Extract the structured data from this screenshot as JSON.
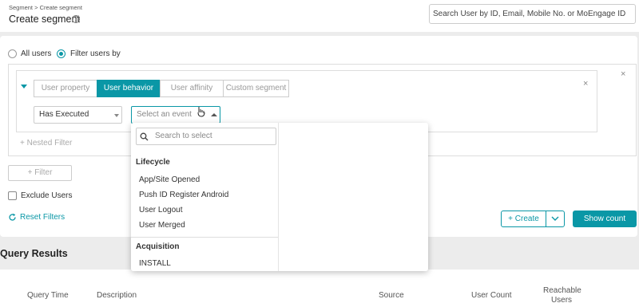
{
  "header": {
    "breadcrumb": "Segment > Create segment",
    "title": "Create segment",
    "help_glyph": "?",
    "search_text": "Search User by ID, Email, Mobile No. or MoEngage ID"
  },
  "audience": {
    "all_users_label": "All users",
    "filter_users_label": "Filter users by",
    "selected": "Filter users by"
  },
  "tabs": [
    {
      "label": "User property",
      "active": false
    },
    {
      "label": "User behavior",
      "active": true
    },
    {
      "label": "User affinity",
      "active": false
    },
    {
      "label": "Custom segment",
      "active": false
    }
  ],
  "condition": {
    "action_value": "Has Executed",
    "event_placeholder": "Select an event"
  },
  "nested_filter_label": "+ Nested Filter",
  "filter_button_label": "+ Filter",
  "exclude_users_label": "Exclude Users",
  "exclude_users_checked": false,
  "reset_filters_label": "Reset Filters",
  "create_button_label": "+ Create",
  "show_count_label": "Show count",
  "query_results_title": "Query Results",
  "table_headers": {
    "query_time": "Query Time",
    "description": "Description",
    "source": "Source",
    "user_count": "User Count",
    "reachable_users": "Reachable Users"
  },
  "event_dropdown": {
    "search_placeholder": "Search to select",
    "groups": [
      {
        "name": "Lifecycle",
        "items": [
          "App/Site Opened",
          "Push ID Register Android",
          "User Logout",
          "User Merged"
        ]
      },
      {
        "name": "Acquisition",
        "items": [
          "INSTALL"
        ]
      }
    ]
  },
  "colors": {
    "accent": "#0a97a6",
    "page_bg": "#ececec"
  },
  "icons": {
    "help": "question-circle-icon",
    "close": "close-icon",
    "search": "search-icon",
    "reset": "refresh-icon",
    "caret": "caret-down-icon"
  }
}
